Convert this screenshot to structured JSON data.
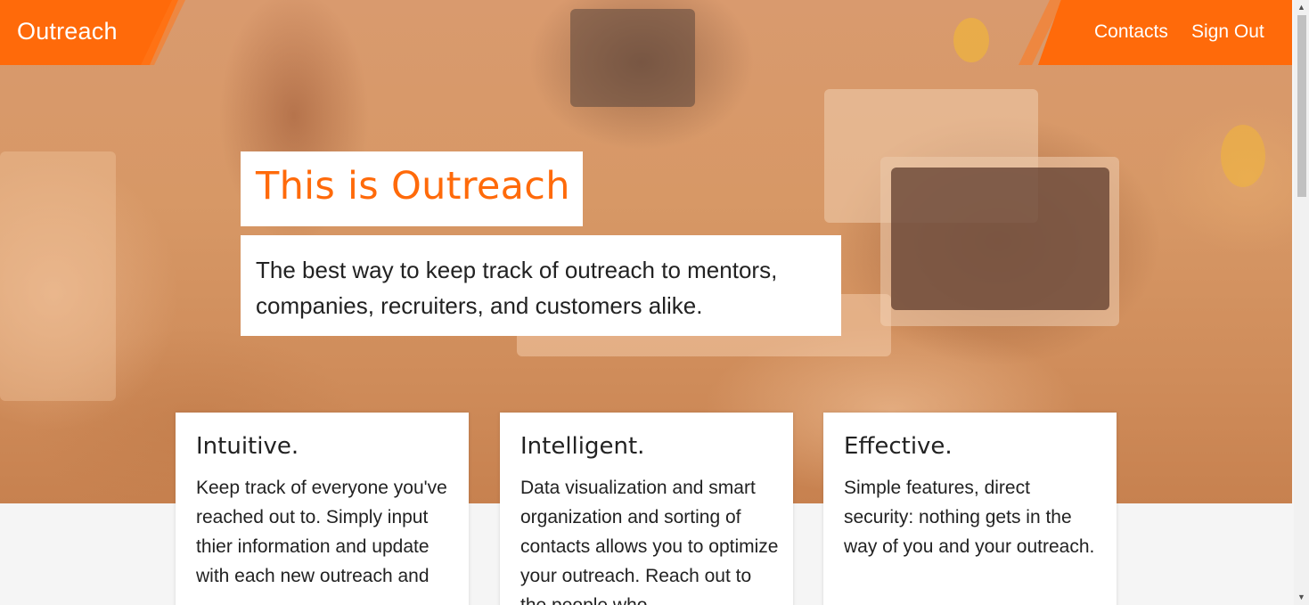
{
  "header": {
    "brand": "Outreach",
    "nav": {
      "contacts": "Contacts",
      "sign_out": "Sign Out"
    },
    "accent_color": "#ff6a0a"
  },
  "hero": {
    "title": "This is Outreach",
    "subtitle": "The best way to keep track of outreach to mentors, companies, recruiters, and customers alike."
  },
  "features": [
    {
      "title": "Intuitive.",
      "text": "Keep track of everyone you've reached out to. Simply input thier information and update with each new outreach and"
    },
    {
      "title": "Intelligent.",
      "text": "Data visualization and smart organization and sorting of contacts allows you to optimize your outreach. Reach out to the people who"
    },
    {
      "title": "Effective.",
      "text": "Simple features, direct security: nothing gets in the way of you and your outreach."
    }
  ],
  "scrollbar": {
    "up_icon": "triangle-up-icon",
    "down_icon": "triangle-down-icon"
  }
}
